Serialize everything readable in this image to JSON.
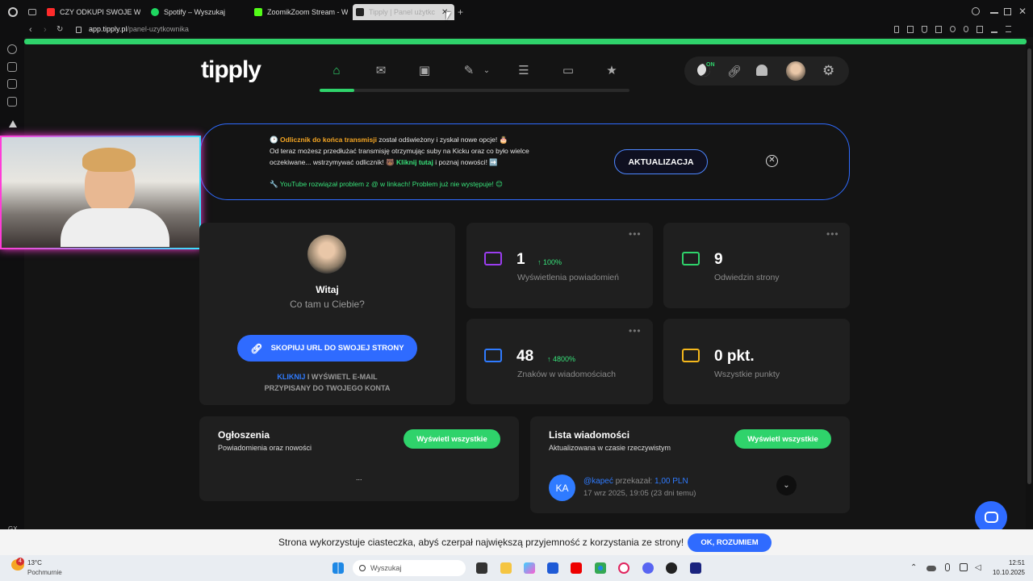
{
  "browser": {
    "tabs": [
      {
        "label": "CZY ODKUPI SWOJE WIN",
        "color": "#ff2b2b"
      },
      {
        "label": "Spotify – Wyszukaj",
        "color": "#1ed760"
      },
      {
        "label": "ZoomikZoom Stream - W",
        "color": "#53fc18"
      },
      {
        "label": "Tipply | Panel użytkc",
        "color": "#222222",
        "active": true
      }
    ],
    "url_host": "app.tipply.pl",
    "url_path": "/panel-uzytkownika",
    "sidebar_bottom": "GX"
  },
  "app": {
    "logo": "tipply",
    "toggle_label": "ON",
    "accent": "#2fd36b"
  },
  "banner": {
    "line1_highlight": "Odlicznik do końca transmisji",
    "line1_rest": " został odświeżony i zyskał nowe opcje! 🎂",
    "line2": "Od teraz możesz przedłużać transmisję otrzymując suby na Kicku oraz co było wielce",
    "line3_start": "oczekiwane... wstrzymywać odlicznik! 🐻",
    "line3_link": "Kliknij tutaj",
    "line3_end": " i poznaj nowości! ➡️",
    "line4": "🔧 YouTube rozwiązał problem z @ w linkach! Problem już nie występuje! 😊",
    "button": "AKTUALIZACJA",
    "close": "✕"
  },
  "profile": {
    "greeting": "Witaj",
    "subtitle": "Co tam u Ciebie?",
    "copy_button": "SKOPIUJ URL DO SWOJEJ STRONY",
    "hint_link": "KLIKNIJ",
    "hint_rest1": " I WYŚWIETL E-MAIL",
    "hint_rest2": "PRZYPISANY DO TWOJEGO KONTA"
  },
  "stats": [
    {
      "value": "1",
      "delta": "↑ 100%",
      "label": "Wyświetlenia powiadomień",
      "color": "#9b3df0"
    },
    {
      "value": "9",
      "delta": "",
      "label": "Odwiedzin strony",
      "color": "#2fd36b"
    },
    {
      "value": "48",
      "delta": "↑ 4800%",
      "label": "Znaków w wiadomościach",
      "color": "#2f7bff"
    },
    {
      "value": "0 pkt.",
      "delta": "",
      "label": "Wszystkie punkty",
      "color": "#f5b81c"
    }
  ],
  "announcements": {
    "title": "Ogłoszenia",
    "subtitle": "Powiadomienia oraz nowości",
    "button": "Wyświetl wszystkie",
    "loading": "..."
  },
  "messages": {
    "title": "Lista wiadomości",
    "subtitle": "Aktualizowana w czasie rzeczywistym",
    "button": "Wyświetl wszystkie",
    "items": [
      {
        "initials": "KA",
        "user": "@kapeć",
        "action": " przekazał: ",
        "amount": "1,00 PLN",
        "date": "17 wrz 2025, 19:05 (23 dni temu)"
      }
    ]
  },
  "cookie": {
    "text": "Strona wykorzystuje ciasteczka, abyś czerpał największą przyjemność z korzystania ze strony!",
    "button": "OK, ROZUMIEM"
  },
  "taskbar": {
    "temp": "13°C",
    "weather": "Pochmurnie",
    "weather_badge": "4",
    "search": "Wyszukaj",
    "time": "12:51",
    "date": "10.10.2025"
  }
}
